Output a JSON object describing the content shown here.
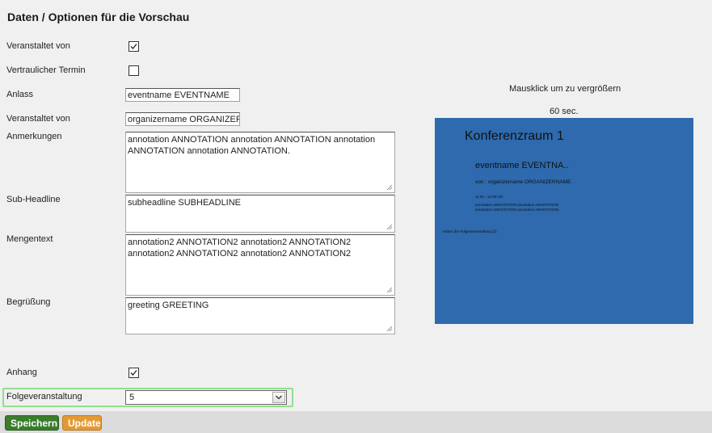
{
  "page": {
    "title": "Daten / Optionen für die Vorschau"
  },
  "form": {
    "veranstaltet_von_cb": {
      "label": "Veranstaltet von",
      "checked": true
    },
    "vertraulich": {
      "label": "Vertraulicher Termin",
      "checked": false
    },
    "anlass": {
      "label": "Anlass",
      "value": "eventname EVENTNAME"
    },
    "veranstaltet_von": {
      "label": "Veranstaltet von",
      "value": "organizername ORGANIZERNAME"
    },
    "anmerkungen": {
      "label": "Anmerkungen",
      "value": "annotation ANNOTATION annotation ANNOTATION annotation ANNOTATION annotation ANNOTATION."
    },
    "subheadline": {
      "label": "Sub-Headline",
      "value": "subheadline SUBHEADLINE"
    },
    "mengentext": {
      "label": "Mengentext",
      "value": "annotation2 ANNOTATION2 annotation2 ANNOTATION2 annotation2 ANNOTATION2 annotation2 ANNOTATION2"
    },
    "begruessung": {
      "label": "Begrüßung",
      "value": "greeting GREETING"
    },
    "anhang": {
      "label": "Anhang",
      "checked": true
    },
    "folgeveranstaltung": {
      "label": "Folgeveranstaltung",
      "value": "5"
    }
  },
  "buttons": {
    "save": "Speichern",
    "update": "Update"
  },
  "preview": {
    "hint": "Mausklick um zu vergrößern",
    "timer": "60 sec.",
    "room": "Konferenzraum 1",
    "event": "eventname EVENTNA..",
    "organizer": "von : organizername ORGANIZERNAME",
    "time": "11:00 - 14:00 Uhr",
    "annotation": "annotation ANNOTATION annotation ANNOTATION annotation ANNOTATION annotation ANNOTATION.",
    "following": "Anlass der Folgeveranstaltung (2)",
    "background_color": "#2e6aad"
  },
  "colors": {
    "save_button": "#3a7d2b",
    "update_button": "#e39a34",
    "highlight": "#8fe08f"
  },
  "icons": {
    "checkbox": "checkmark-icon",
    "select": "chevron-down-icon",
    "resize": "resize-grip-icon"
  }
}
